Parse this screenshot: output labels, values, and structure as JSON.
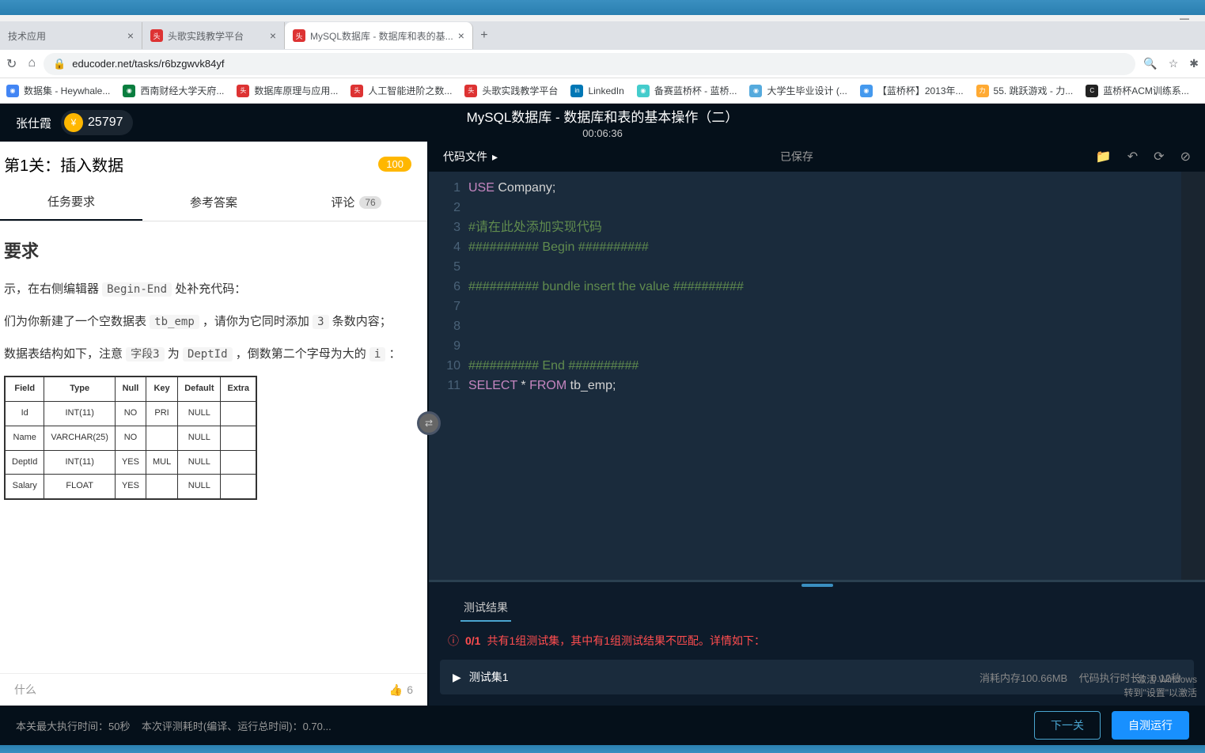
{
  "browser": {
    "tabs": [
      {
        "title": "技术应用",
        "active": false
      },
      {
        "title": "头歌实践教学平台",
        "active": false,
        "icon_color": "red"
      },
      {
        "title": "MySQL数据库 - 数据库和表的基...",
        "active": true,
        "icon_color": "red"
      }
    ],
    "url": "educoder.net/tasks/r6bzgwvk84yf",
    "bookmarks": [
      {
        "label": "数据集 - Heywhale..."
      },
      {
        "label": "西南财经大学天府..."
      },
      {
        "label": "数据库原理与应用..."
      },
      {
        "label": "人工智能进阶之数..."
      },
      {
        "label": "头歌实践教学平台"
      },
      {
        "label": "LinkedIn"
      },
      {
        "label": "备赛蓝桥杯 - 蓝桥..."
      },
      {
        "label": "大学生毕业设计 (..."
      },
      {
        "label": "【蓝桥杯】2013年..."
      },
      {
        "label": "55. 跳跃游戏 - 力..."
      },
      {
        "label": "蓝桥杯ACM训练系..."
      }
    ]
  },
  "header": {
    "user_name": "张仕霞",
    "coins": "25797",
    "title": "MySQL数据库 - 数据库和表的基本操作（二）",
    "timer": "00:06:36"
  },
  "left": {
    "level_title": "第1关：插入数据",
    "score": "100",
    "tabs": {
      "task": "任务要求",
      "answer": "参考答案",
      "comment": "评论",
      "comment_count": "76"
    },
    "content": {
      "heading": "要求",
      "p1_prefix": "示，在右侧编辑器 ",
      "p1_code": "Begin-End",
      "p1_suffix": " 处补充代码：",
      "p2_prefix": "们为你新建了一个空数据表 ",
      "p2_code": "tb_emp",
      "p2_mid": " ，请你为它同时添加 ",
      "p2_code2": "3",
      "p2_suffix": " 条数内容；",
      "p3_prefix": "数据表结构如下，注意 ",
      "p3_code1": "字段3",
      "p3_mid1": " 为 ",
      "p3_code2": "DeptId",
      "p3_mid2": " ，倒数第二个字母为大的 ",
      "p3_code3": "i",
      "p3_suffix": " ：",
      "table": {
        "headers": [
          "Field",
          "Type",
          "Null",
          "Key",
          "Default",
          "Extra"
        ],
        "rows": [
          [
            "Id",
            "INT(11)",
            "NO",
            "PRI",
            "NULL",
            ""
          ],
          [
            "Name",
            "VARCHAR(25)",
            "NO",
            "",
            "NULL",
            ""
          ],
          [
            "DeptId",
            "INT(11)",
            "YES",
            "MUL",
            "NULL",
            ""
          ],
          [
            "Salary",
            "FLOAT",
            "YES",
            "",
            "NULL",
            ""
          ]
        ]
      }
    },
    "footer_hint": "什么",
    "likes": "6"
  },
  "editor": {
    "file_label": "代码文件",
    "saved_label": "已保存",
    "lines": [
      {
        "n": "1",
        "html": "<span class='kw'>USE</span> <span class='plain'>Company;</span>"
      },
      {
        "n": "2",
        "html": ""
      },
      {
        "n": "3",
        "html": "<span class='comment'>#请在此处添加实现代码</span>"
      },
      {
        "n": "4",
        "html": "<span class='comment'>########## Begin ##########</span>"
      },
      {
        "n": "5",
        "html": ""
      },
      {
        "n": "6",
        "html": "<span class='comment'>########## bundle insert the value ##########</span>"
      },
      {
        "n": "7",
        "html": ""
      },
      {
        "n": "8",
        "html": ""
      },
      {
        "n": "9",
        "html": ""
      },
      {
        "n": "10",
        "html": "<span class='comment'>########## End ##########</span>"
      },
      {
        "n": "11",
        "html": "<span class='kw'>SELECT</span> <span class='plain'>*</span> <span class='kw'>FROM</span> <span class='plain'>tb_emp;</span>"
      }
    ]
  },
  "test": {
    "tab_label": "测试结果",
    "summary_count": "0/1",
    "summary_text": "共有1组测试集，其中有1组测试结果不匹配。详情如下：",
    "set_label": "测试集1",
    "memory_label": "消耗内存",
    "memory_value": "100.66MB",
    "time_label": "代码执行时长：",
    "time_value": "0.12秒"
  },
  "bottom": {
    "max_time": "本关最大执行时间：50秒",
    "eval_time": "本次评测耗时(编译、运行总时间)：0.70...",
    "next_btn": "下一关",
    "self_test_btn": "自测运行"
  },
  "activation": {
    "line1": "激活 Windows",
    "line2": "转到\"设置\"以激活"
  }
}
